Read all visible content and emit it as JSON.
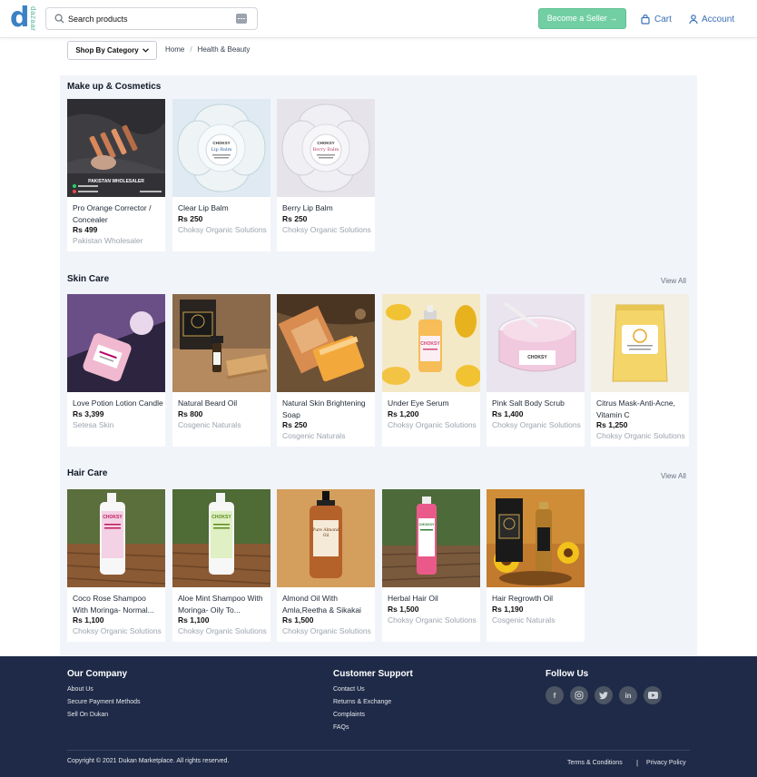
{
  "header": {
    "logo": "dazaar",
    "search_placeholder": "Search products",
    "seller_button": "Become a Seller →",
    "cart_label": "Cart",
    "account_label": "Account"
  },
  "subnav": {
    "category_button": "Shop By Category",
    "breadcrumb": [
      "Home",
      "/",
      "Health & Beauty"
    ]
  },
  "sections": [
    {
      "title": "Make up & Cosmetics",
      "view_all": "",
      "products": [
        {
          "name": "Pro Orange Corrector / Concealer",
          "price": "Rs 499",
          "seller": "Pakistan Wholesaler"
        },
        {
          "name": "Clear Lip Balm",
          "price": "Rs 250",
          "seller": "Choksy Organic Solutions"
        },
        {
          "name": "Berry Lip Balm",
          "price": "Rs 250",
          "seller": "Choksy Organic Solutions"
        }
      ]
    },
    {
      "title": "Skin Care",
      "view_all": "View All",
      "products": [
        {
          "name": "Love Potion Lotion Candle",
          "price": "Rs 3,399",
          "seller": "Setesa Skin"
        },
        {
          "name": "Natural Beard Oil",
          "price": "Rs 800",
          "seller": "Cosgenic Naturals"
        },
        {
          "name": "Natural Skin Brightening Soap",
          "price": "Rs 250",
          "seller": "Cosgenic Naturals"
        },
        {
          "name": "Under Eye Serum",
          "price": "Rs 1,200",
          "seller": "Choksy Organic Solutions"
        },
        {
          "name": "Pink Salt Body Scrub",
          "price": "Rs 1,400",
          "seller": "Choksy Organic Solutions"
        },
        {
          "name": "Citrus Mask-Anti-Acne, Vitamin C",
          "price": "Rs 1,250",
          "seller": "Choksy Organic Solutions"
        }
      ]
    },
    {
      "title": "Hair Care",
      "view_all": "View All",
      "products": [
        {
          "name": "Coco Rose Shampoo With Moringa- Normal...",
          "price": "Rs 1,100",
          "seller": "Choksy Organic Solutions"
        },
        {
          "name": "Aloe Mint Shampoo With Moringa- Oily To...",
          "price": "Rs 1,100",
          "seller": "Choksy Organic Solutions"
        },
        {
          "name": "Almond Oil With Amla,Reetha & Sikakai",
          "price": "Rs 1,500",
          "seller": "Choksy Organic Solutions"
        },
        {
          "name": "Herbal Hair Oil",
          "price": "Rs 1,500",
          "seller": "Choksy Organic Solutions"
        },
        {
          "name": "Hair Regrowth Oil",
          "price": "Rs 1,190",
          "seller": "Cosgenic Naturals"
        }
      ]
    }
  ],
  "footer": {
    "our_company": {
      "title": "Our Company",
      "links": [
        "About Us",
        "Secure Payment Methods",
        "Sell On Dukan"
      ]
    },
    "customer_support": {
      "title": "Customer Support",
      "links": [
        "Contact Us",
        "Returns & Exchange",
        "Complaints",
        "FAQs"
      ]
    },
    "follow_us": {
      "title": "Follow Us",
      "icons": [
        "facebook-icon",
        "instagram-icon",
        "twitter-icon",
        "linkedin-icon",
        "youtube-icon"
      ]
    },
    "copyright": "Copyright © 2021 Dukan Marketplace. All rights reserved.",
    "terms": "Terms & Conditions",
    "separator": "|",
    "privacy": "Privacy Policy"
  },
  "colors": {
    "brand_blue": "#3b6fb6",
    "seller_green": "#72cfa4",
    "panel_bg": "#f1f4f9",
    "footer_bg": "#1e2a47"
  }
}
